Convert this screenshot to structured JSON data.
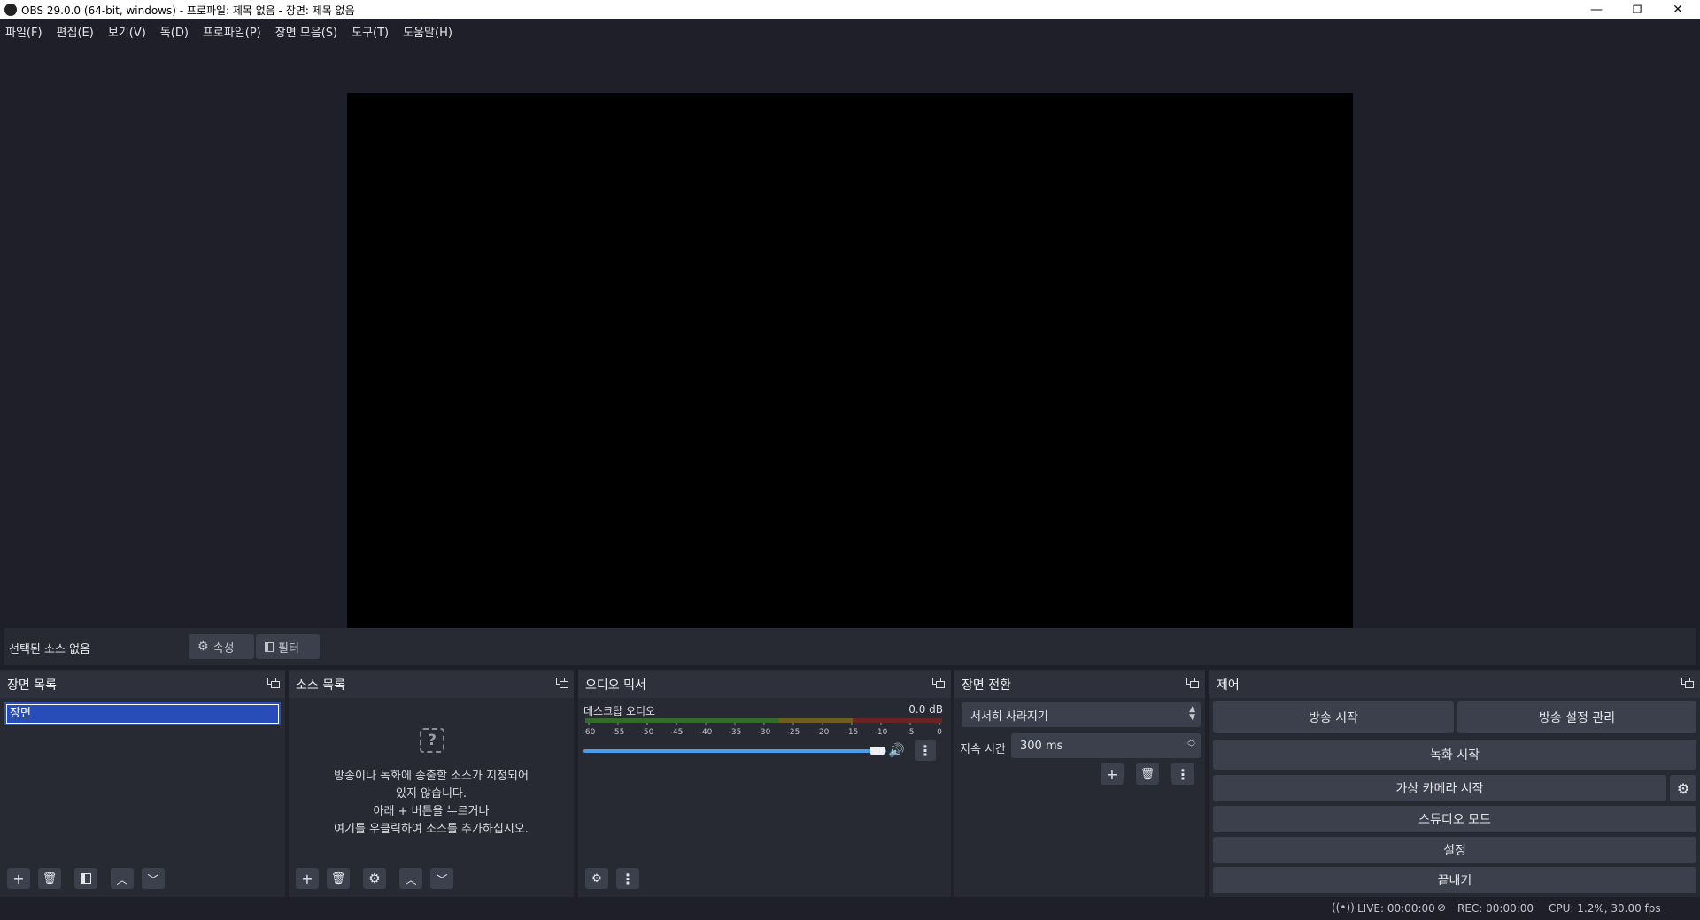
{
  "window": {
    "title": "OBS 29.0.0 (64-bit, windows) - 프로파일: 제목 없음 - 장면: 제목 없음",
    "minimize": "—",
    "restore": "❐",
    "close": "✕"
  },
  "menu": [
    "파일(F)",
    "편집(E)",
    "보기(V)",
    "독(D)",
    "프로파일(P)",
    "장면 모음(S)",
    "도구(T)",
    "도움말(H)"
  ],
  "context_bar": {
    "no_source": "선택된 소스 없음",
    "properties": "속성",
    "filters": "필터"
  },
  "scenes": {
    "title": "장면 목록",
    "items": [
      "장면"
    ]
  },
  "sources": {
    "title": "소스 목록",
    "empty_lines": [
      "방송이나 녹화에 송출할 소스가 지정되어",
      "있지 않습니다.",
      "아래 + 버튼을 누르거나",
      "여기를 우클릭하여 소스를 추가하십시오."
    ]
  },
  "mixer": {
    "title": "오디오 믹서",
    "channel": "데스크탑 오디오",
    "level": "0.0 dB",
    "ticks": [
      "-60",
      "-55",
      "-50",
      "-45",
      "-40",
      "-35",
      "-30",
      "-25",
      "-20",
      "-15",
      "-10",
      "-5",
      "0"
    ],
    "volume": 1.0
  },
  "transitions": {
    "title": "장면 전환",
    "selected": "서서히 사라지기",
    "duration_label": "지속 시간",
    "duration_value": "300 ms"
  },
  "controls": {
    "title": "제어",
    "start_streaming": "방송 시작",
    "manage_broadcast": "방송 설정 관리",
    "start_recording": "녹화 시작",
    "start_virtual_camera": "가상 카메라 시작",
    "studio_mode": "스튜디오 모드",
    "settings": "설정",
    "exit": "끝내기"
  },
  "status": {
    "live": "LIVE: 00:00:00",
    "rec": "REC: 00:00:00",
    "cpu": "CPU: 1.2%, 30.00 fps"
  },
  "colors": {
    "bg": "#1e1f29",
    "panel": "#272a33",
    "button": "#3c404d",
    "selection": "#284cb8",
    "slider": "#4a9eea"
  }
}
